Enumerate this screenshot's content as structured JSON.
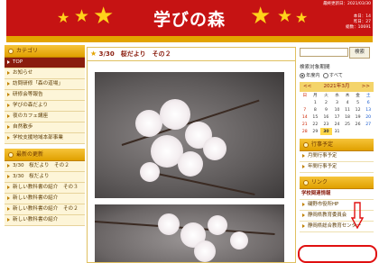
{
  "header": {
    "title": "学びの森",
    "updated": "最終更新日：2021/03/30",
    "counts": [
      "本日：14",
      "昨日：27",
      "総数：10691"
    ]
  },
  "left": {
    "sections": [
      {
        "title": "カテゴリ",
        "items": [
          "TOP",
          "お知らせ",
          "訪問研修「森の道場」",
          "研修会等報告",
          "学びの森だより",
          "夜のカフェ講座",
          "自然散歩",
          "学校支援地域本部事業"
        ]
      },
      {
        "title": "最新の更新",
        "items": [
          "3/30　桜だより　その２",
          "3/30　桜だより",
          "新しい教科書の紹介　その３",
          "新しい教科書の紹介",
          "新しい教科書の紹介　その２",
          "新しい教科書の紹介"
        ]
      }
    ],
    "active_index": 0
  },
  "main": {
    "post_title": "3/30　桜だより　その２"
  },
  "right": {
    "search_button": "検索",
    "period_label": "検索対象期間",
    "radio_year": "年度内",
    "radio_all": "すべて",
    "calendar": {
      "prev": "<<",
      "next": ">>",
      "month": "2021年3月",
      "weekdays": [
        "日",
        "月",
        "火",
        "水",
        "木",
        "金",
        "土"
      ],
      "weeks": [
        [
          "",
          "1",
          "2",
          "3",
          "4",
          "5",
          "6"
        ],
        [
          "7",
          "8",
          "9",
          "10",
          "11",
          "12",
          "13"
        ],
        [
          "14",
          "15",
          "16",
          "17",
          "18",
          "19",
          "20"
        ],
        [
          "21",
          "22",
          "23",
          "24",
          "25",
          "26",
          "27"
        ],
        [
          "28",
          "29",
          "30",
          "31",
          "",
          "",
          ""
        ]
      ],
      "today": "30"
    },
    "schedule_title": "行事予定",
    "schedule_items": [
      "月間行事予定",
      "年間行事予定"
    ],
    "links_title": "リンク",
    "links_subheading": "学校関連情報",
    "links": [
      "磯野市役所HP",
      "静岡県教育委員会",
      "静岡県総合教育センター"
    ]
  },
  "colors": {
    "header_red": "#c61313",
    "gold": "#e3a400",
    "accent_maroon": "#8a1d0e",
    "highlight_red": "#e01010"
  }
}
